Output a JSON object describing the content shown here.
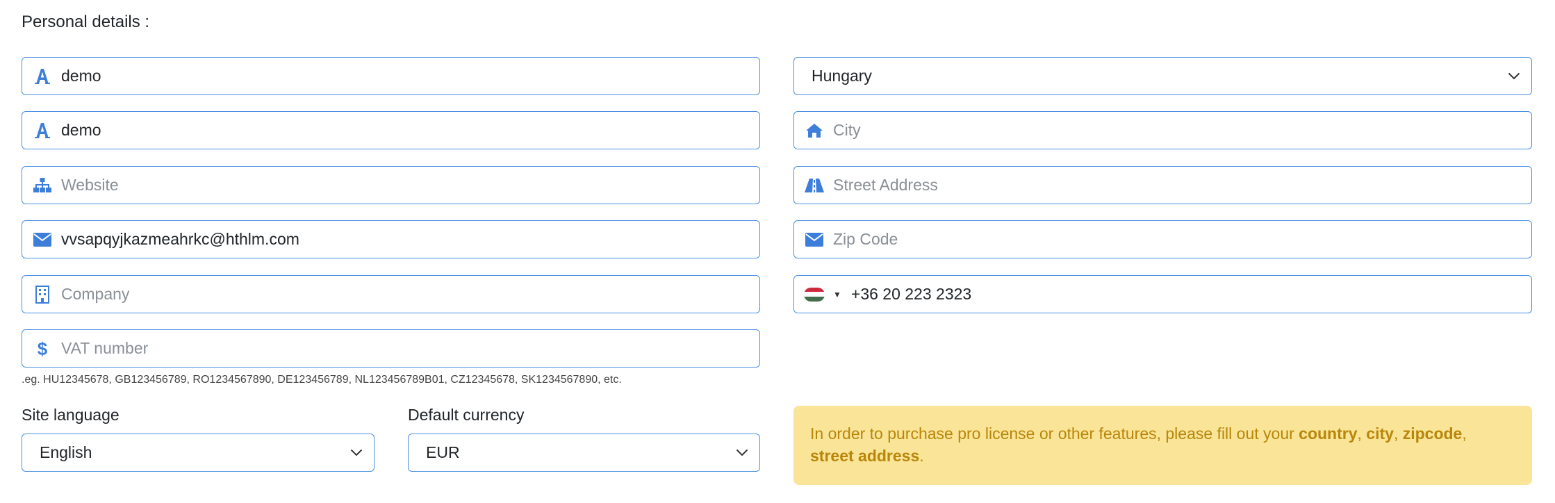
{
  "heading": "Personal details :",
  "left_fields": {
    "first_name": {
      "value": "demo",
      "placeholder": "",
      "icon": "font-icon"
    },
    "last_name": {
      "value": "demo",
      "placeholder": "",
      "icon": "font-icon"
    },
    "website": {
      "value": "",
      "placeholder": "Website",
      "icon": "sitemap-icon"
    },
    "email": {
      "value": "vvsapqyjkazmeahrkc@hthlm.com",
      "placeholder": "",
      "icon": "envelope-icon"
    },
    "company": {
      "value": "",
      "placeholder": "Company",
      "icon": "building-icon"
    },
    "vat": {
      "value": "",
      "placeholder": "VAT number",
      "icon": "dollar-icon"
    }
  },
  "vat_hint": ".eg. HU12345678, GB123456789, RO1234567890, DE123456789, NL123456789B01, CZ12345678, SK1234567890, etc.",
  "right_fields": {
    "country": {
      "selected": "Hungary"
    },
    "city": {
      "value": "",
      "placeholder": "City",
      "icon": "home-icon"
    },
    "street": {
      "value": "",
      "placeholder": "Street Address",
      "icon": "road-icon"
    },
    "zip": {
      "value": "",
      "placeholder": "Zip Code",
      "icon": "envelope-icon"
    },
    "phone": {
      "value": "+36 20 223 2323",
      "flag": "hungary-flag"
    }
  },
  "site_language": {
    "label": "Site language",
    "selected": "English"
  },
  "default_currency": {
    "label": "Default currency",
    "selected": "EUR"
  },
  "alert": {
    "prefix": "In order to purchase pro license or other features, please fill out your ",
    "country": "country",
    "sep1": ", ",
    "city": "city",
    "sep2": ", ",
    "zipcode": "zipcode",
    "sep3": ",",
    "street": "street address",
    "suffix": "."
  },
  "colors": {
    "accent": "#4a8fe2",
    "alert_bg": "#f9e497",
    "alert_text": "#b8860b"
  }
}
